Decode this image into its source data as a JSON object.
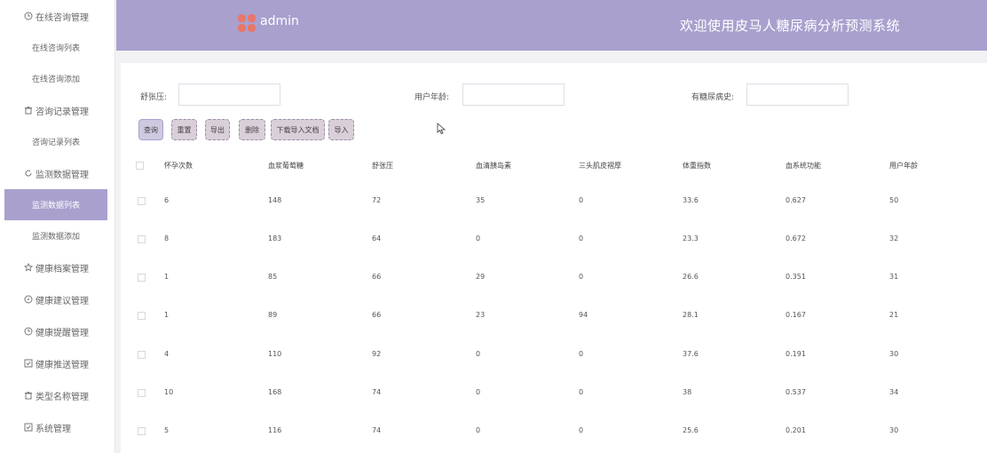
{
  "sidebar": {
    "groups": [
      {
        "label": "在线咨询管理",
        "icon": "clock-icon"
      },
      {
        "label": "咨询记录管理",
        "icon": "trash-icon"
      },
      {
        "label": "监测数据管理",
        "icon": "refresh-icon"
      },
      {
        "label": "健康档案管理",
        "icon": "star-icon"
      },
      {
        "label": "健康建议管理",
        "icon": "compass-icon"
      },
      {
        "label": "健康提醒管理",
        "icon": "clock-icon"
      },
      {
        "label": "健康推送管理",
        "icon": "check-square-icon"
      },
      {
        "label": "类型名称管理",
        "icon": "trash-icon"
      },
      {
        "label": "系统管理",
        "icon": "check-square-icon"
      }
    ],
    "items": {
      "consult_list": "在线咨询列表",
      "consult_add": "在线咨询添加",
      "record_list": "咨询记录列表",
      "monitor_list": "监测数据列表",
      "monitor_add": "监测数据添加"
    }
  },
  "header": {
    "logo_text": "admin",
    "title": "欢迎使用皮马人糖尿病分析预测系统",
    "accent": "#a9a0ce"
  },
  "filters": {
    "diastolic_label": "舒张压:",
    "diastolic_value": "",
    "age_label": "用户年龄:",
    "age_value": "",
    "diabetes_label": "有糖尿病史:",
    "diabetes_value": ""
  },
  "buttons": {
    "query": "查询",
    "reset": "重置",
    "export": "导出",
    "delete": "删除",
    "download_template": "下载导入文档",
    "import": "导入"
  },
  "table": {
    "headers": [
      "怀孕次数",
      "血浆葡萄糖",
      "舒张压",
      "血清胰岛素",
      "三头肌皮褶厚",
      "体重指数",
      "血系统功能",
      "用户年龄"
    ],
    "rows": [
      [
        "6",
        "148",
        "72",
        "35",
        "0",
        "33.6",
        "0.627",
        "50"
      ],
      [
        "8",
        "183",
        "64",
        "0",
        "0",
        "23.3",
        "0.672",
        "32"
      ],
      [
        "1",
        "85",
        "66",
        "29",
        "0",
        "26.6",
        "0.351",
        "31"
      ],
      [
        "1",
        "89",
        "66",
        "23",
        "94",
        "28.1",
        "0.167",
        "21"
      ],
      [
        "4",
        "110",
        "92",
        "0",
        "0",
        "37.6",
        "0.191",
        "30"
      ],
      [
        "10",
        "168",
        "74",
        "0",
        "0",
        "38",
        "0.537",
        "34"
      ],
      [
        "5",
        "116",
        "74",
        "0",
        "0",
        "25.6",
        "0.201",
        "30"
      ]
    ]
  }
}
